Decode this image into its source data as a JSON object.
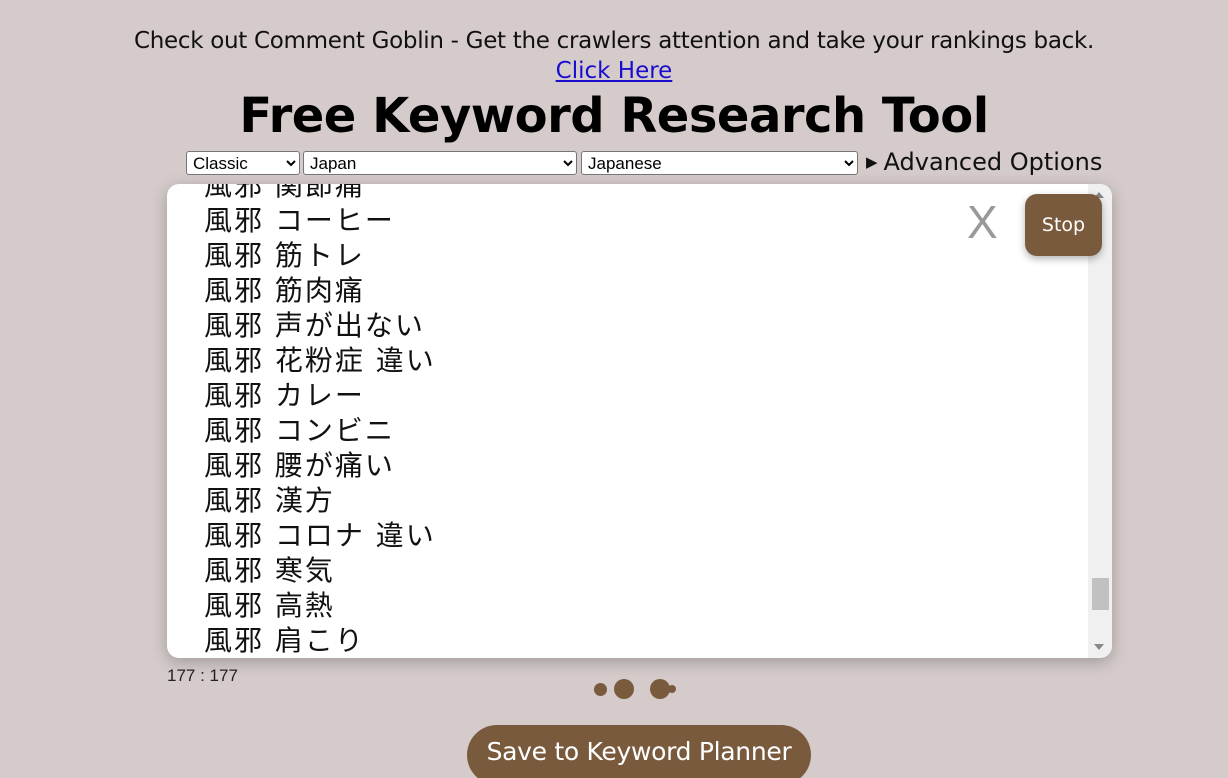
{
  "promo": {
    "text": "Check out Comment Goblin - Get the crawlers attention and take your rankings back.",
    "link_label": "Click Here"
  },
  "title": "Free Keyword Research Tool",
  "controls": {
    "mode": {
      "selected": "Classic"
    },
    "country": {
      "selected": "Japan"
    },
    "language": {
      "selected": "Japanese"
    },
    "advanced_label": "Advanced Options"
  },
  "results": {
    "keywords": [
      "風邪 関節痛",
      "風邪 コーヒー",
      "風邪 筋トレ",
      "風邪 筋肉痛",
      "風邪 声が出ない",
      "風邪 花粉症 違い",
      "風邪 カレー",
      "風邪 コンビニ",
      "風邪 腰が痛い",
      "風邪 漢方",
      "風邪 コロナ 違い",
      "風邪 寒気",
      "風邪 高熱",
      "風邪 肩こり"
    ],
    "close_label": "X",
    "scroll_progress": 0.93
  },
  "stop_label": "Stop",
  "count_text": "177 : 177",
  "save_label": "Save to Keyword Planner",
  "colors": {
    "accent": "#7a5a3c",
    "background": "#d5cbcb",
    "link": "#1a0dcc"
  }
}
